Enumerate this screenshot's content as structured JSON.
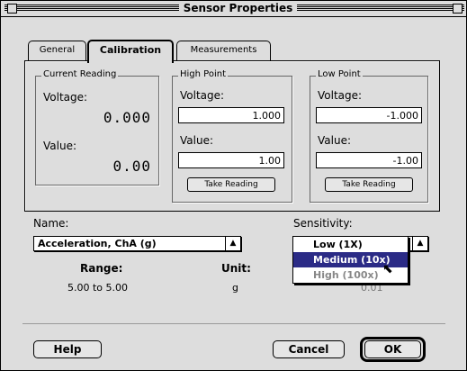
{
  "window": {
    "title": "Sensor Properties"
  },
  "tabs": [
    {
      "label": "General",
      "active": false
    },
    {
      "label": "Calibration",
      "active": true
    },
    {
      "label": "Measurements",
      "active": false
    }
  ],
  "current_reading": {
    "legend": "Current Reading",
    "voltage_label": "Voltage:",
    "voltage_value": "0.000",
    "value_label": "Value:",
    "value_value": "0.00"
  },
  "high_point": {
    "legend": "High Point",
    "voltage_label": "Voltage:",
    "voltage_value": "1.000",
    "value_label": "Value:",
    "value_value": "1.00",
    "button": "Take Reading"
  },
  "low_point": {
    "legend": "Low Point",
    "voltage_label": "Voltage:",
    "voltage_value": "-1.000",
    "value_label": "Value:",
    "value_value": "-1.00",
    "button": "Take Reading"
  },
  "name": {
    "label": "Name:",
    "selected": "Acceleration, ChA (g)"
  },
  "sensitivity": {
    "label": "Sensitivity:",
    "options": [
      "Low (1X)",
      "Medium (10x)",
      "High (100x)"
    ],
    "highlighted": "Medium (10x)",
    "disabled": "High (100x)"
  },
  "range": {
    "label": "Range:",
    "value": "5.00 to 5.00"
  },
  "unit": {
    "label": "Unit:",
    "value": "g"
  },
  "resolution_partial": "0.01",
  "buttons": {
    "help": "Help",
    "cancel": "Cancel",
    "ok": "OK"
  },
  "colors": {
    "highlight": "#2b2b86",
    "window_bg": "#dddddd"
  }
}
